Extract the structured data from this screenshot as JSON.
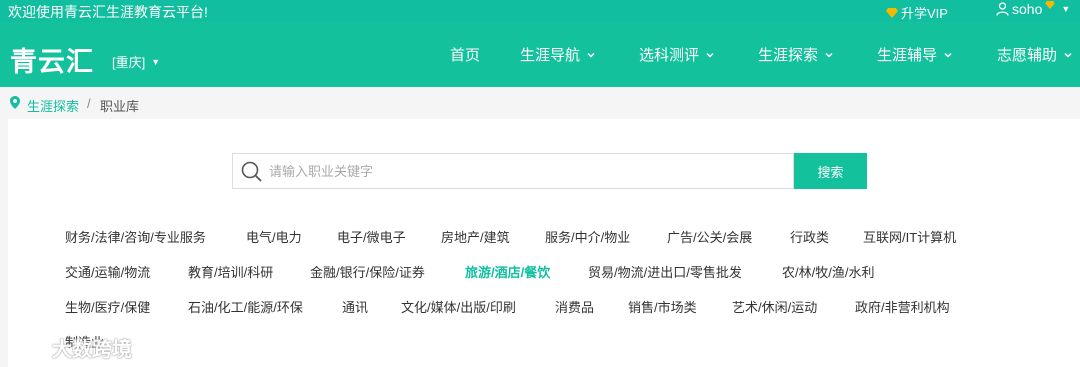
{
  "topbar": {
    "welcome": "欢迎使用青云汇生涯教育云平台!",
    "vip_label": "升学VIP",
    "user_name": "soho"
  },
  "navbar": {
    "logo": "青云汇",
    "city": "[重庆]",
    "items": [
      {
        "label": "首页"
      },
      {
        "label": "生涯导航"
      },
      {
        "label": "选科测评"
      },
      {
        "label": "生涯探索"
      },
      {
        "label": "生涯辅导"
      },
      {
        "label": "志愿辅助"
      }
    ]
  },
  "breadcrumb": {
    "parent": "生涯探索",
    "separator": "/",
    "current": "职业库"
  },
  "search": {
    "placeholder": "请输入职业关键字",
    "button_label": "搜索"
  },
  "categories": [
    {
      "label": "财务/法律/咨询/专业服务"
    },
    {
      "label": "电气/电力"
    },
    {
      "label": "电子/微电子"
    },
    {
      "label": "房地产/建筑"
    },
    {
      "label": "服务/中介/物业"
    },
    {
      "label": "广告/公关/会展"
    },
    {
      "label": "行政类"
    },
    {
      "label": "互联网/IT计算机"
    },
    {
      "label": "交通/运输/物流"
    },
    {
      "label": "教育/培训/科研"
    },
    {
      "label": "金融/银行/保险/证券"
    },
    {
      "label": "旅游/酒店/餐饮",
      "active": true
    },
    {
      "label": "贸易/物流/进出口/零售批发"
    },
    {
      "label": "农/林/牧/渔/水利"
    },
    {
      "label": "生物/医疗/保健"
    },
    {
      "label": "石油/化工/能源/环保"
    },
    {
      "label": "通讯"
    },
    {
      "label": "文化/媒体/出版/印刷"
    },
    {
      "label": "消费品"
    },
    {
      "label": "销售/市场类"
    },
    {
      "label": "艺术/休闲/运动"
    },
    {
      "label": "政府/非营利机构"
    },
    {
      "label": "制造业"
    }
  ],
  "watermark": "大数跨境",
  "colors": {
    "brand": "#13c19d",
    "vip_gold": "#f5b800"
  }
}
